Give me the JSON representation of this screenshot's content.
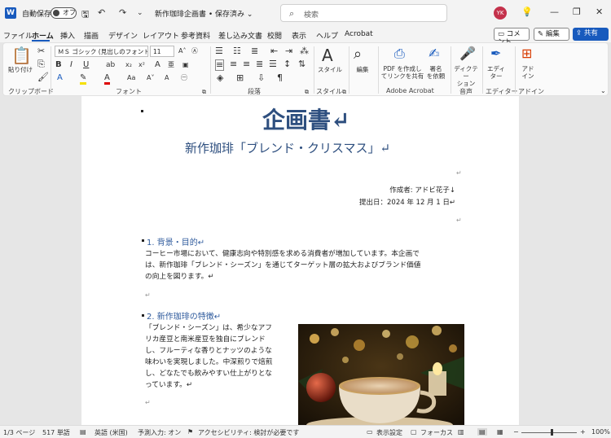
{
  "titlebar": {
    "app_icon": "W",
    "autosave_label": "自動保存",
    "autosave_state": "オフ",
    "doc_title": "新作珈琲企画書 • 保存済み ⌄",
    "search_placeholder": "検索",
    "avatar_initials": "YK"
  },
  "tabs": [
    "ファイル",
    "ホーム",
    "挿入",
    "描画",
    "デザイン",
    "レイアウト",
    "参考資料",
    "差し込み文書",
    "校閲",
    "表示",
    "ヘルプ",
    "Acrobat"
  ],
  "actions": {
    "comment": "コメント",
    "edit": "編集 ⌄",
    "share": "共有 ⌄"
  },
  "ribbon": {
    "clipboard": {
      "paste": "貼り付け",
      "label": "クリップボード"
    },
    "font": {
      "name": "ＭＳ ゴシック (見出しのフォント - 日",
      "size": "11",
      "label": "フォント"
    },
    "paragraph": {
      "label": "段落"
    },
    "styles": {
      "button": "スタイル",
      "label": "スタイル"
    },
    "editing": {
      "button": "編集"
    },
    "adobe": {
      "create_pdf": "PDF を作成し\nてリンクを共有",
      "sign": "署名\nを依頼",
      "label": "Adobe Acrobat"
    },
    "voice": {
      "dictate": "ディクテー\nション",
      "label": "音声"
    },
    "editor": {
      "button": "エディ\nター",
      "label": "エディター"
    },
    "addin": {
      "button": "アド\nイン",
      "label": "アドイン"
    }
  },
  "document": {
    "title": "企画書↵",
    "subtitle": "新作珈琲「ブレンド・クリスマス」↵",
    "author": "作成者: アドビ花子↓",
    "date": "提出日：2024 年 12 月 1 日↵",
    "pilcrow": "↵",
    "section1_heading": "1. 背景・目的↵",
    "section1_lines": [
      "コーヒー市場において、健康志向や特別感を求める消費者が増加しています。本企画で",
      "は、新作珈琲「ブレンド・シーズン」を通じてターゲット層の拡大およびブランド価値",
      "の向上を図ります。↵"
    ],
    "section2_heading": "2. 新作珈琲の特徴↵",
    "section2_lines": [
      "「ブレンド・シーズン」は、希少なアフ",
      "リカ産豆と南米産豆を独自にブレンド",
      "し、フルーティな香りとナッツのような",
      "味わいを実現しました。中深煎りで焙煎",
      "し、どなたでも飲みやすい仕上がりとな",
      "っています。↵"
    ]
  },
  "status": {
    "page": "1/3 ページ",
    "words": "517 単語",
    "language": "英語 (米国)",
    "predict": "予測入力: オン",
    "accessibility": "アクセシビリティ: 検討が必要です",
    "display_settings": "表示設定",
    "focus": "フォーカス",
    "zoom": "100%"
  }
}
